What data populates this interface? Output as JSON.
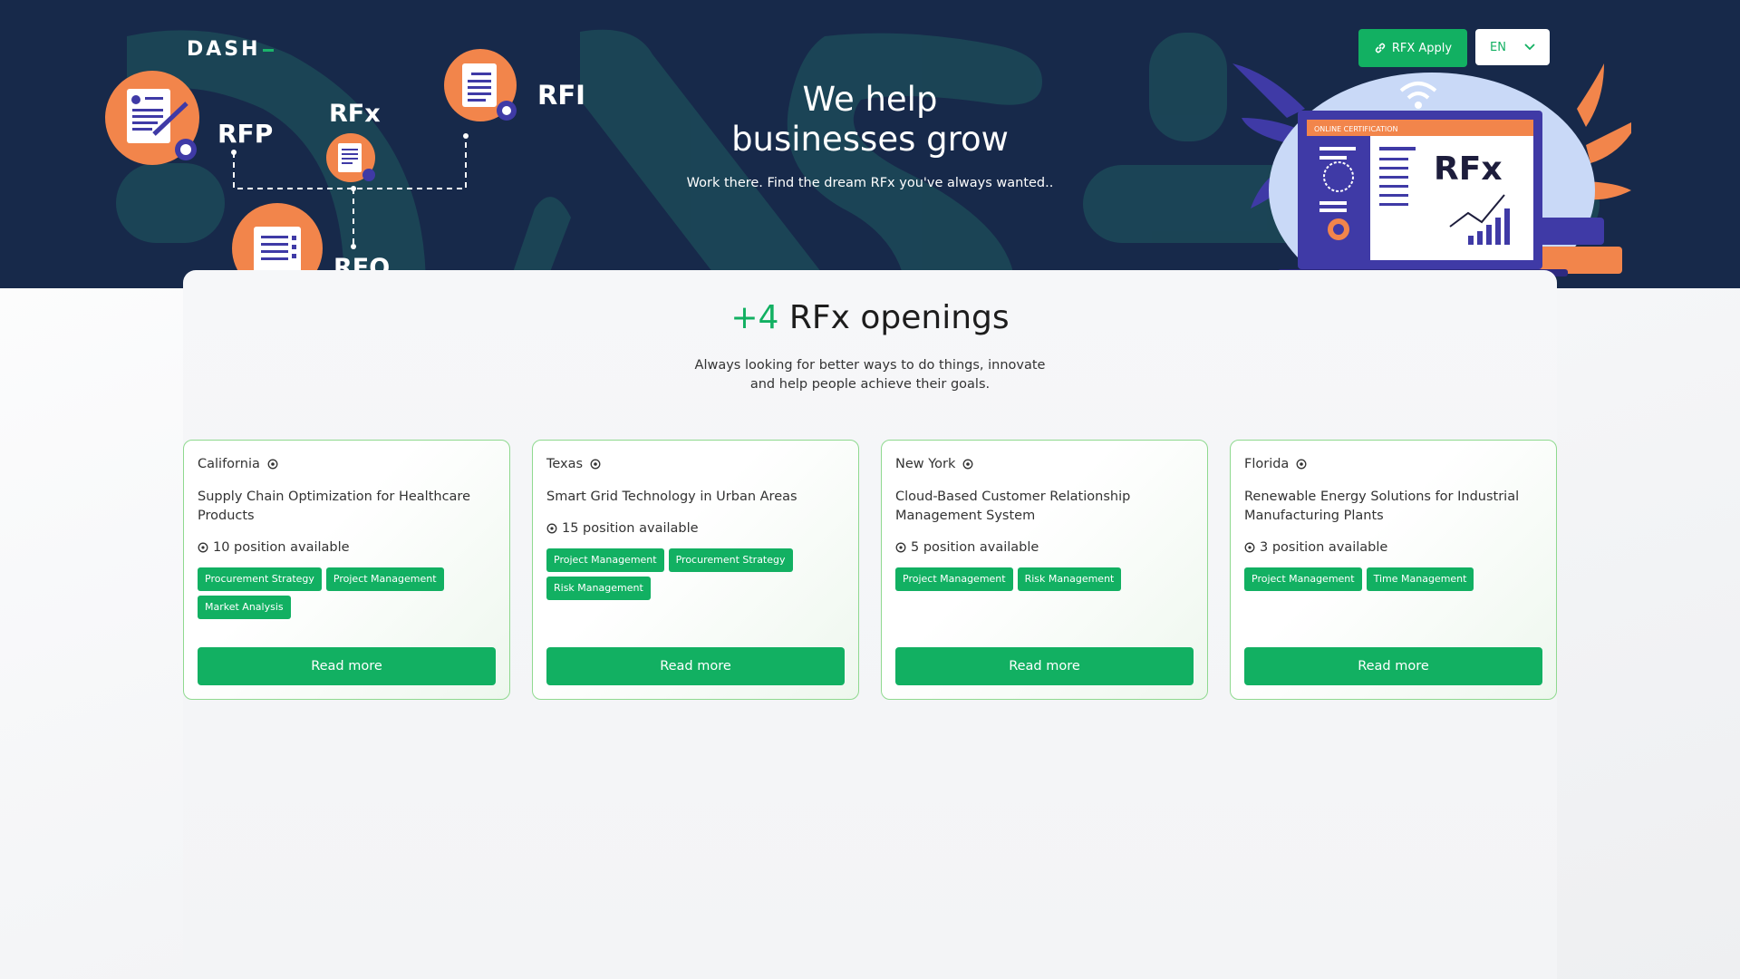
{
  "header": {
    "logo": "DASH",
    "title_line1": "We help",
    "title_line2": "businesses grow",
    "subtitle": "Work there. Find the dream RFx you've always wanted..",
    "labels": {
      "rfp": "RFP",
      "rfx": "RFx",
      "rfi": "RFI",
      "rfq": "RFQ"
    },
    "illustration_screen_label": "RFx",
    "illustration_banner": "ONLINE CERTIFICATION",
    "apply_button": "RFX Apply",
    "language": "EN"
  },
  "openings": {
    "count": "+4",
    "title": "RFx openings",
    "subtitle_line1": "Always looking for better ways to do things, innovate",
    "subtitle_line2": "and help people achieve their goals."
  },
  "cards": [
    {
      "location": "California",
      "title": "Supply Chain Optimization for Healthcare Products",
      "positions": "10 position available",
      "tags": [
        "Procurement Strategy",
        "Project Management",
        "Market Analysis"
      ],
      "button": "Read more"
    },
    {
      "location": "Texas",
      "title": "Smart Grid Technology in Urban Areas",
      "positions": "15 position available",
      "tags": [
        "Project Management",
        "Procurement Strategy",
        "Risk Management"
      ],
      "button": "Read more"
    },
    {
      "location": "New York",
      "title": "Cloud-Based Customer Relationship Management System",
      "positions": "5 position available",
      "tags": [
        "Project Management",
        "Risk Management"
      ],
      "button": "Read more"
    },
    {
      "location": "Florida",
      "title": "Renewable Energy Solutions for Industrial Manufacturing Plants",
      "positions": "3 position available",
      "tags": [
        "Project Management",
        "Time Management"
      ],
      "button": "Read more"
    }
  ],
  "colors": {
    "hero_bg": "#17294a",
    "accent": "#12b062",
    "orange": "#f2854b",
    "purple": "#3f3aa6"
  },
  "icons": {
    "location": "location-pin-icon",
    "positions": "target-icon",
    "apply": "link-icon",
    "language": "chevron-down-icon"
  }
}
